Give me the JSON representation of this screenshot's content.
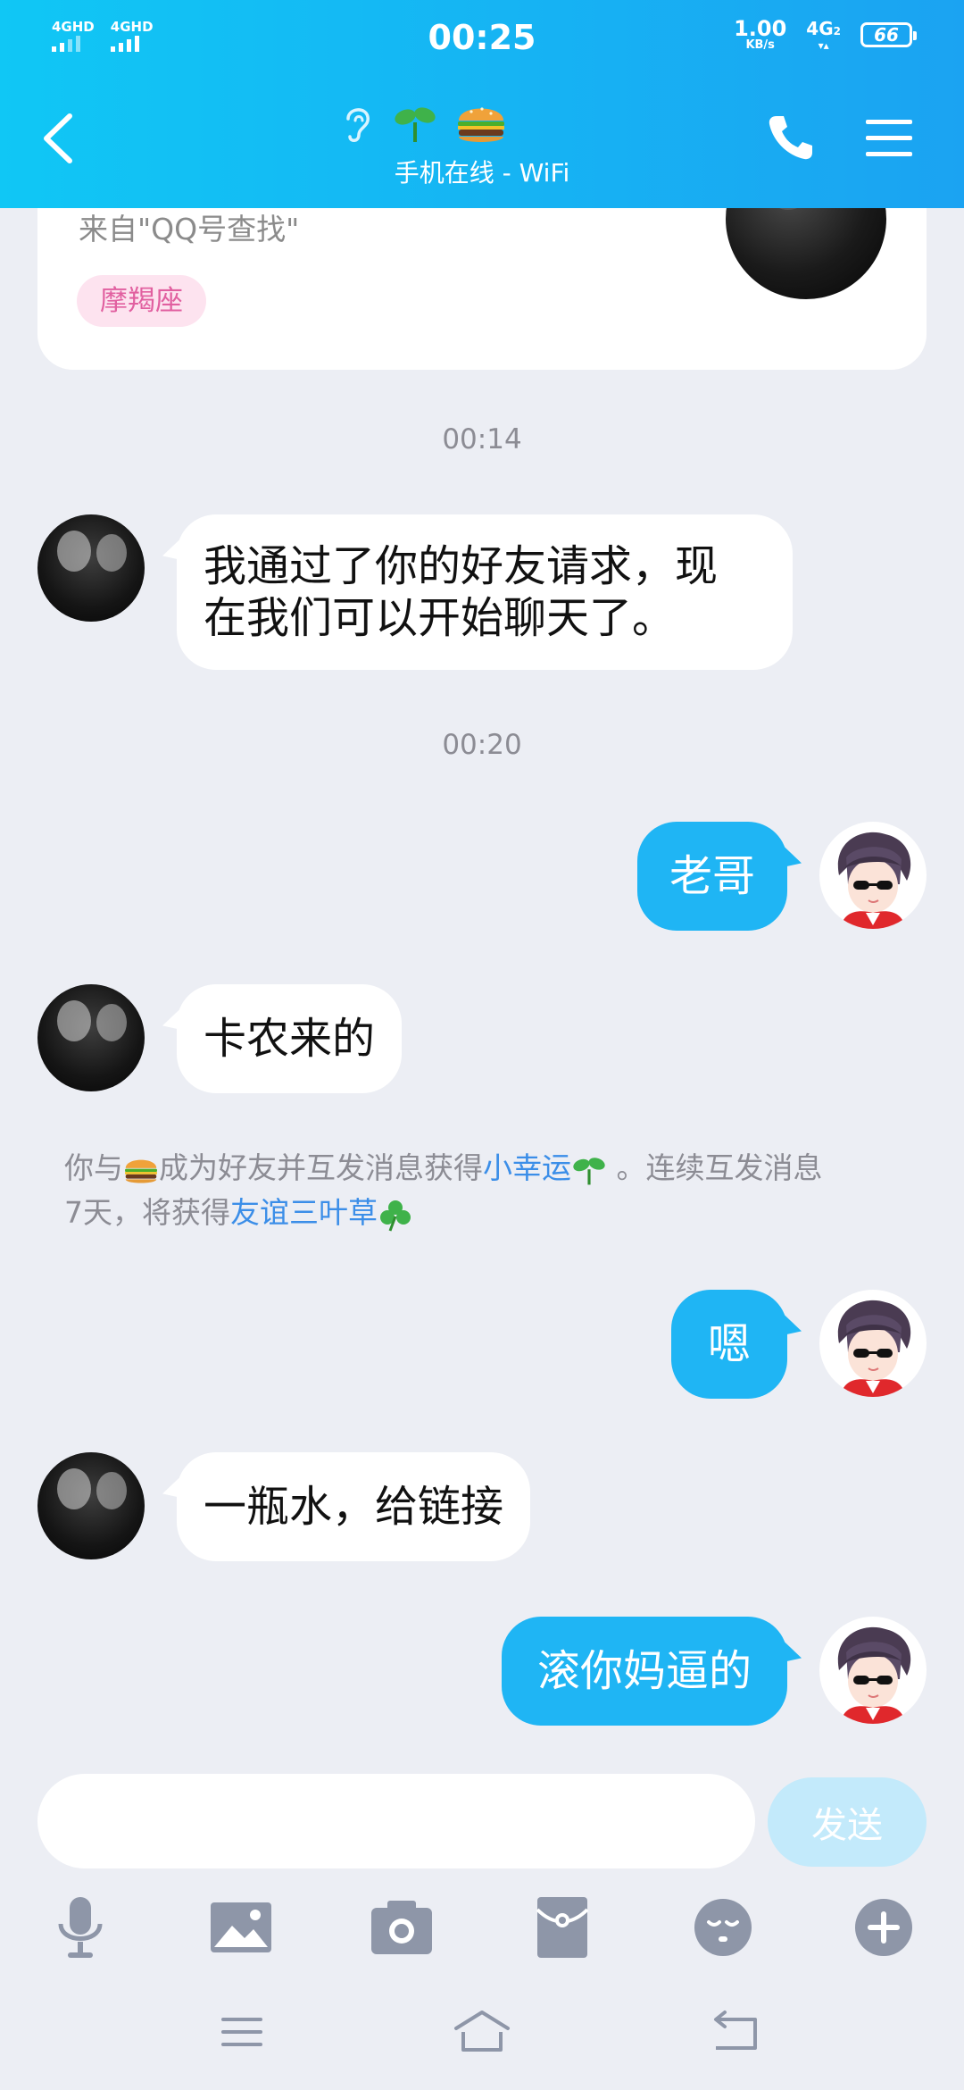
{
  "status_bar": {
    "signal_1": "4GHD",
    "signal_2": "4GHD",
    "time": "00:25",
    "net_speed": "1.00",
    "net_unit": "KB/s",
    "net_type": "4G",
    "net_type_sub": "2",
    "battery": "66"
  },
  "header": {
    "subtitle": "手机在线 - WiFi",
    "icons": [
      "back-icon",
      "ear-icon",
      "sprout-icon",
      "burger-emoji-icon",
      "phone-icon",
      "menu-icon"
    ]
  },
  "profile_card": {
    "from": "来自\"QQ号查找\"",
    "zodiac": "摩羯座"
  },
  "messages": [
    {
      "type": "time",
      "text": "00:14"
    },
    {
      "type": "in",
      "text_line1": "我通过了你的好友请求，现",
      "text_line2": "在我们可以开始聊天了。"
    },
    {
      "type": "time",
      "text": "00:20"
    },
    {
      "type": "out",
      "text": "老哥"
    },
    {
      "type": "in",
      "text": "卡农来的"
    },
    {
      "type": "notice",
      "p1": "你与",
      "p2": "成为好友并互发消息获得",
      "link1": "小幸运",
      "p3": " 。连续互发消息",
      "p4": "7天，将获得",
      "link2": "友谊三叶草"
    },
    {
      "type": "out",
      "text": "嗯"
    },
    {
      "type": "in",
      "text": "一瓶水，给链接"
    },
    {
      "type": "out",
      "text": "滚你妈逼的"
    }
  ],
  "composer": {
    "placeholder": "",
    "send_label": "发送"
  },
  "toolbar": [
    "mic-icon",
    "image-icon",
    "camera-icon",
    "red-packet-icon",
    "emoji-icon",
    "plus-icon"
  ],
  "navbar": [
    "recent-apps-icon",
    "home-icon",
    "back-nav-icon"
  ],
  "colors": {
    "header_start": "#10c7f5",
    "header_end": "#1ba3f2",
    "outgoing_bubble": "#1fb5f4",
    "background": "#eceef4",
    "link": "#3b8ee8",
    "send_disabled": "#c3eafb"
  }
}
